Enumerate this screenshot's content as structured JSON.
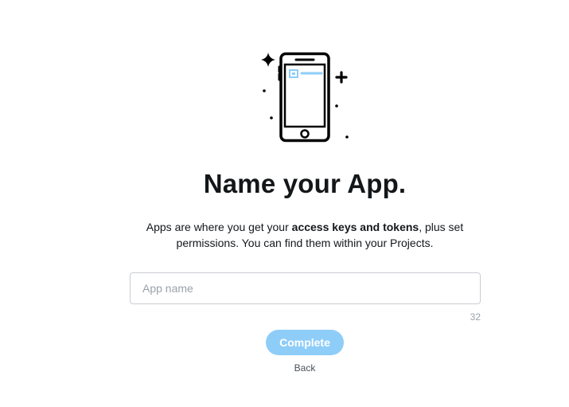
{
  "header": {
    "title": "Name your App."
  },
  "description": {
    "before": "Apps are where you get your ",
    "emphasis": "access keys and tokens",
    "after": ", plus set permissions. You can find them within your Projects."
  },
  "form": {
    "app_name": {
      "value": "",
      "placeholder": "App name",
      "remaining_chars": "32"
    }
  },
  "actions": {
    "complete_label": "Complete",
    "back_label": "Back"
  },
  "illustration": {
    "icon": "mobile-phone-icon",
    "accent_color": "#8ecdf8"
  },
  "colors": {
    "primary_button_disabled": "#8ecdf8",
    "text": "#14171a",
    "muted": "#9aa2ab"
  }
}
